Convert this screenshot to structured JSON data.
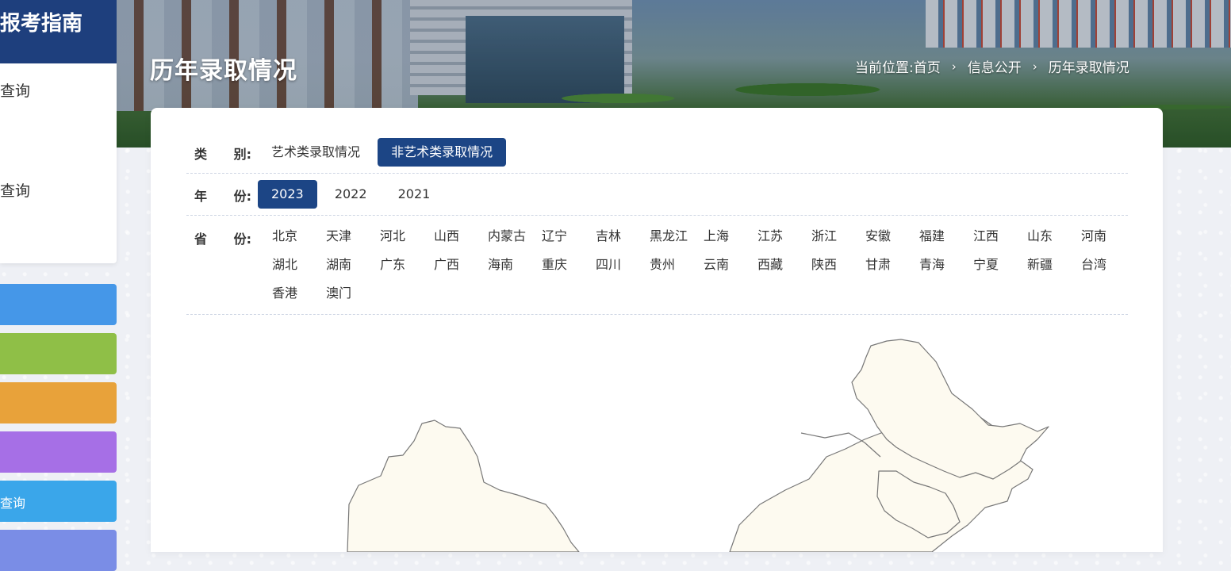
{
  "sidebar": {
    "title": "报考指南",
    "menu": [
      "查询",
      "查询"
    ],
    "buttons": [
      {
        "label": "",
        "color": "#4597e8"
      },
      {
        "label": "",
        "color": "#8fbf47"
      },
      {
        "label": "",
        "color": "#e8a23a"
      },
      {
        "label": "",
        "color": "#a66fe6"
      },
      {
        "label": "查询",
        "color": "#3aa6ea"
      },
      {
        "label": "",
        "color": "#7a8de6"
      }
    ]
  },
  "header": {
    "title": "历年录取情况",
    "breadcrumb": {
      "prefix": "当前位置:",
      "items": [
        "首页",
        "信息公开",
        "历年录取情况"
      ]
    }
  },
  "filters": {
    "category": {
      "label_chars": [
        "类",
        "别:"
      ],
      "options": [
        "艺术类录取情况",
        "非艺术类录取情况"
      ],
      "selected": "非艺术类录取情况"
    },
    "year": {
      "label_chars": [
        "年",
        "份:"
      ],
      "options": [
        "2023",
        "2022",
        "2021"
      ],
      "selected": "2023"
    },
    "province": {
      "label_chars": [
        "省",
        "份:"
      ],
      "options": [
        "北京",
        "天津",
        "河北",
        "山西",
        "内蒙古",
        "辽宁",
        "吉林",
        "黑龙江",
        "上海",
        "江苏",
        "浙江",
        "安徽",
        "福建",
        "江西",
        "山东",
        "河南",
        "湖北",
        "湖南",
        "广东",
        "广西",
        "海南",
        "重庆",
        "四川",
        "贵州",
        "云南",
        "西藏",
        "陕西",
        "甘肃",
        "青海",
        "宁夏",
        "新疆",
        "台湾",
        "香港",
        "澳门"
      ]
    }
  },
  "colors": {
    "accent": "#1c4585",
    "sidebar_head": "#1e3f7d",
    "map_fill": "#fdfaf0",
    "map_stroke": "#777777"
  }
}
